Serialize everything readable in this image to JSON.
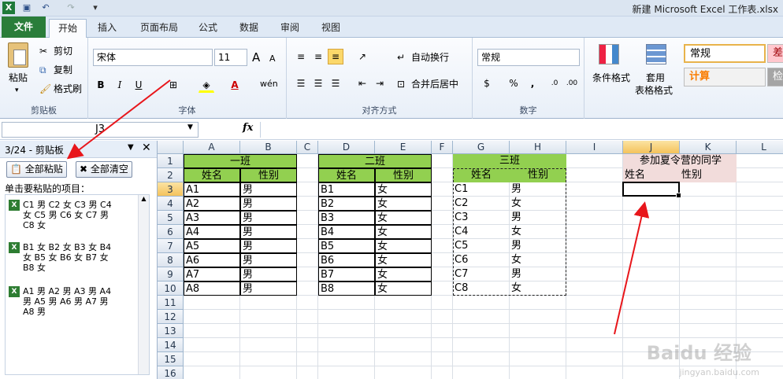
{
  "titlebar": {
    "title": "新建 Microsoft Excel 工作表.xlsx",
    "icons": [
      "excel-icon",
      "save-icon",
      "undo-icon",
      "redo-icon",
      "customize-icon"
    ]
  },
  "tabs": [
    {
      "label": "文件",
      "name": "tab-file"
    },
    {
      "label": "开始",
      "name": "tab-home"
    },
    {
      "label": "插入",
      "name": "tab-insert"
    },
    {
      "label": "页面布局",
      "name": "tab-page-layout"
    },
    {
      "label": "公式",
      "name": "tab-formulas"
    },
    {
      "label": "数据",
      "name": "tab-data"
    },
    {
      "label": "审阅",
      "name": "tab-review"
    },
    {
      "label": "视图",
      "name": "tab-view"
    }
  ],
  "ribbon": {
    "clipboard": {
      "paste": "粘贴",
      "cut": "剪切",
      "copy": "复制",
      "format_painter": "格式刷",
      "label": "剪贴板"
    },
    "font": {
      "name": "宋体",
      "size": "11",
      "label": "字体",
      "bold": "B",
      "italic": "I",
      "underline": "U",
      "grow": "A",
      "shrink": "A",
      "phonetic": "wén"
    },
    "alignment": {
      "wrap": "自动换行",
      "merge": "合并后居中",
      "label": "对齐方式"
    },
    "number": {
      "format": "常规",
      "percent": "%",
      "comma": ",",
      "label": "数字"
    },
    "styles": {
      "conditional": "条件格式",
      "table_format_1": "套用",
      "table_format_2": "表格格式",
      "normal": "常规",
      "bad": "差",
      "calc": "计算",
      "check": "检"
    }
  },
  "formula_bar": {
    "name_box": "J3",
    "fx": "fx",
    "value": ""
  },
  "clipboard_pane": {
    "title": "3/24 - 剪贴板",
    "paste_all": "全部粘贴",
    "clear_all": "全部清空",
    "instruction": "单击要粘贴的项目：",
    "items": [
      {
        "line1": "C1 男 C2 女 C3 男 C4",
        "line2": "女 C5 男 C6 女 C7 男",
        "line3": "C8 女"
      },
      {
        "line1": "B1 女 B2 女 B3 女 B4",
        "line2": "女 B5 女 B6 女 B7 女",
        "line3": "B8 女"
      },
      {
        "line1": "A1 男 A2 男 A3 男 A4",
        "line2": "男 A5 男 A6 男 A7 男",
        "line3": "A8 男"
      }
    ]
  },
  "sheet": {
    "columns": [
      "A",
      "B",
      "C",
      "D",
      "E",
      "F",
      "G",
      "H",
      "I",
      "J",
      "K",
      "L"
    ],
    "rows": [
      "1",
      "2",
      "3",
      "4",
      "5",
      "6",
      "7",
      "8",
      "9",
      "10",
      "11",
      "12",
      "13",
      "14",
      "15",
      "16"
    ],
    "class1": {
      "title": "一班",
      "h1": "姓名",
      "h2": "性别",
      "names": [
        "A1",
        "A2",
        "A3",
        "A4",
        "A5",
        "A6",
        "A7",
        "A8"
      ],
      "genders": [
        "男",
        "男",
        "男",
        "男",
        "男",
        "男",
        "男",
        "男"
      ]
    },
    "class2": {
      "title": "二班",
      "h1": "姓名",
      "h2": "性别",
      "names": [
        "B1",
        "B2",
        "B3",
        "B4",
        "B5",
        "B6",
        "B7",
        "B8"
      ],
      "genders": [
        "女",
        "女",
        "女",
        "女",
        "女",
        "女",
        "女",
        "女"
      ]
    },
    "class3": {
      "title": "三班",
      "h1": "姓名",
      "h2": "性别",
      "names": [
        "C1",
        "C2",
        "C3",
        "C4",
        "C5",
        "C6",
        "C7",
        "C8"
      ],
      "genders": [
        "男",
        "女",
        "男",
        "女",
        "男",
        "女",
        "男",
        "女"
      ]
    },
    "camp": {
      "title": "参加夏令营的同学",
      "h1": "姓名",
      "h2": "性别"
    }
  },
  "watermark": {
    "brand": "Baidu 经验",
    "url": "jingyan.baidu.com"
  },
  "colors": {
    "header_green": "#92d050",
    "pink": "#f2dcdb",
    "file_tab": "#2a7d3a",
    "arrow": "#e8161b"
  }
}
